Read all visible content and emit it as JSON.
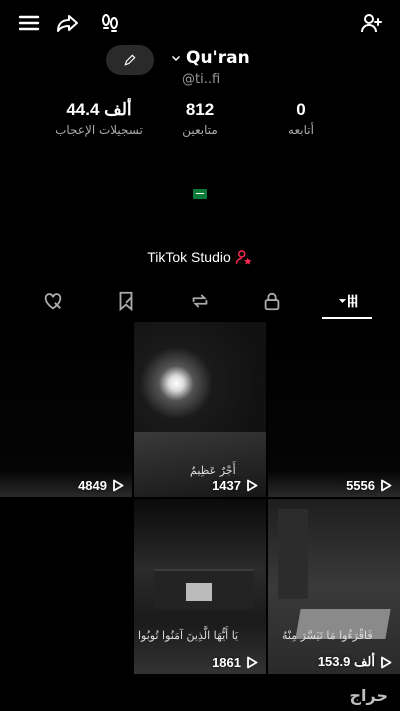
{
  "profile": {
    "username": "Qu'ran",
    "handle": "@ti..fi",
    "stats": [
      {
        "num": "44.4 ألف",
        "label": "تسجيلات الإعجاب"
      },
      {
        "num": "812",
        "label": "متابعين"
      },
      {
        "num": "0",
        "label": "أتابعه"
      }
    ]
  },
  "studio": {
    "label": "TikTok Studio"
  },
  "tabs": [
    {
      "icon": "liked-heart-icon"
    },
    {
      "icon": "favorites-icon"
    },
    {
      "icon": "repost-icon"
    },
    {
      "icon": "private-lock-icon"
    },
    {
      "icon": "videos-grid-icon",
      "active": true
    }
  ],
  "videos": [
    {
      "views": "4849"
    },
    {
      "views": "1437",
      "caption": "أَجْرٌ عَظِيمٌ"
    },
    {
      "views": "5556"
    },
    {
      "views": "",
      "caption": ""
    },
    {
      "views": "1861",
      "caption": "يَا أَيُّهَا الَّذِينَ آمَنُوا تُوبُوا"
    },
    {
      "views": "153.9 ألف",
      "caption": "فَاقْرَءُوا مَا تَيَسَّرَ مِنْهُ"
    }
  ],
  "watermark": "حراج",
  "colors": {
    "background": "#000000",
    "accent_red": "#fe2c55",
    "muted": "#9a9a9a"
  }
}
